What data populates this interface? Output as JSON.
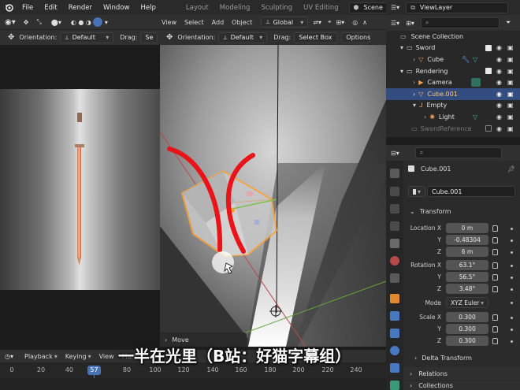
{
  "topbar": {
    "menus": [
      "File",
      "Edit",
      "Render",
      "Window",
      "Help"
    ],
    "workspaces": [
      "Layout",
      "Modeling",
      "Sculpting",
      "UV Editing"
    ],
    "scene": "Scene",
    "view_layer": "ViewLayer"
  },
  "left_editor": {
    "orientation_label": "Orientation:",
    "orientation_value": "Default",
    "drag_label": "Drag:",
    "drag_value_partial": "Se"
  },
  "viewport": {
    "menus": [
      "View",
      "Select",
      "Add",
      "Object"
    ],
    "transform_orientation": "Global",
    "orientation_label": "Orientation:",
    "orientation_value": "Default",
    "drag_label": "Drag:",
    "drag_value": "Select Box",
    "options_label": "Options",
    "operator_panel": "Move"
  },
  "outliner": {
    "items": [
      {
        "label": "Scene Collection",
        "indent": 0,
        "kind": "scene"
      },
      {
        "label": "Sword",
        "indent": 1,
        "kind": "collection"
      },
      {
        "label": "Cube",
        "indent": 2,
        "kind": "mesh"
      },
      {
        "label": "Rendering",
        "indent": 1,
        "kind": "collection"
      },
      {
        "label": "Camera",
        "indent": 2,
        "kind": "camera"
      },
      {
        "label": "Cube.001",
        "indent": 2,
        "kind": "mesh",
        "selected": true
      },
      {
        "label": "Empty",
        "indent": 2,
        "kind": "empty"
      },
      {
        "label": "Light",
        "indent": 3,
        "kind": "light"
      },
      {
        "label": "SwordReference",
        "indent": 1,
        "kind": "collection",
        "dim": true
      }
    ]
  },
  "properties": {
    "object_name": "Cube.001",
    "datablock_name": "Cube.001",
    "transform_header": "Transform",
    "location": {
      "label": "Location X",
      "y_label": "Y",
      "z_label": "Z",
      "x": "0 m",
      "y": "-0.48304",
      "z": "6 m"
    },
    "rotation": {
      "label": "Rotation X",
      "y_label": "Y",
      "z_label": "Z",
      "x": "63.1°",
      "y": "56.5°",
      "z": "3.48°"
    },
    "mode_label": "Mode",
    "mode_value": "XYZ Euler",
    "scale": {
      "label": "Scale X",
      "y_label": "Y",
      "z_label": "Z",
      "x": "0.300",
      "y": "0.300",
      "z": "0.300"
    },
    "delta_transform": "Delta Transform",
    "relations": "Relations",
    "collections": "Collections"
  },
  "timeline": {
    "menus": [
      "Playback",
      "Keying",
      "View",
      "Marker"
    ],
    "current_frame": "57",
    "ticks": [
      "0",
      "20",
      "40",
      "57",
      "80",
      "100",
      "120",
      "140",
      "160",
      "180",
      "200",
      "220",
      "240"
    ],
    "end_frame_partial": "57"
  },
  "caption": "一半在光里（B站：好猫字幕组）",
  "colors": {
    "accent": "#4772b3",
    "selection": "#334d80",
    "active_object": "#ffa033",
    "annotation": "#e8141a"
  }
}
